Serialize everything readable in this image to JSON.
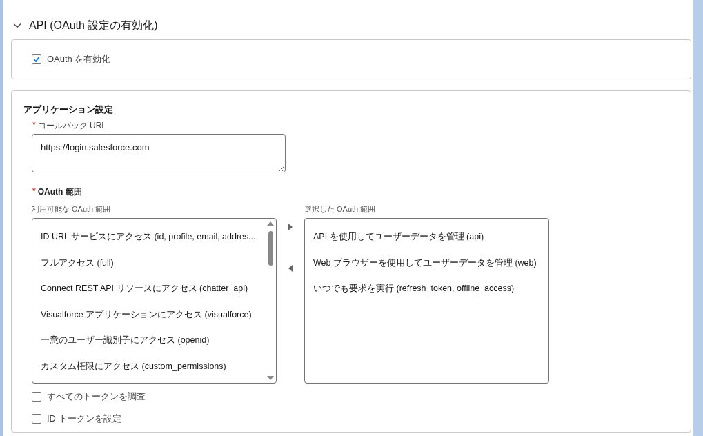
{
  "section": {
    "title": "API (OAuth 設定の有効化)",
    "expanded": true
  },
  "enable_oauth": {
    "label": "OAuth を有効化",
    "checked": true
  },
  "app_settings": {
    "title": "アプリケーション設定",
    "callback_url": {
      "label": "コールバック URL",
      "required_mark": "*",
      "value": "https://login.salesforce.com"
    },
    "oauth_scopes": {
      "label": "OAuth 範囲",
      "required_mark": "*",
      "available": {
        "label": "利用可能な OAuth 範囲",
        "items": [
          {
            "text": "ID URL サービスにアクセス (id, profile, email, addres..."
          },
          {
            "text": "フルアクセス (full)"
          },
          {
            "text": "Connect REST API リソースにアクセス (chatter_api)"
          },
          {
            "text": "Visualforce アプリケーションにアクセス (visualforce)"
          },
          {
            "text": "一意のユーザー識別子にアクセス (openid)"
          },
          {
            "text": "カスタム権限にアクセス (custom_permissions)"
          }
        ]
      },
      "selected": {
        "label": "選択した OAuth 範囲",
        "items": [
          {
            "text": "API を使用してユーザーデータを管理 (api)"
          },
          {
            "text": "Web ブラウザーを使用してユーザーデータを管理 (web)"
          },
          {
            "text": "いつでも要求を実行 (refresh_token, offline_access)"
          }
        ]
      }
    },
    "options": [
      {
        "label": "すべてのトークンを調査",
        "checked": false
      },
      {
        "label": "ID トークンを設定",
        "checked": false
      }
    ]
  }
}
